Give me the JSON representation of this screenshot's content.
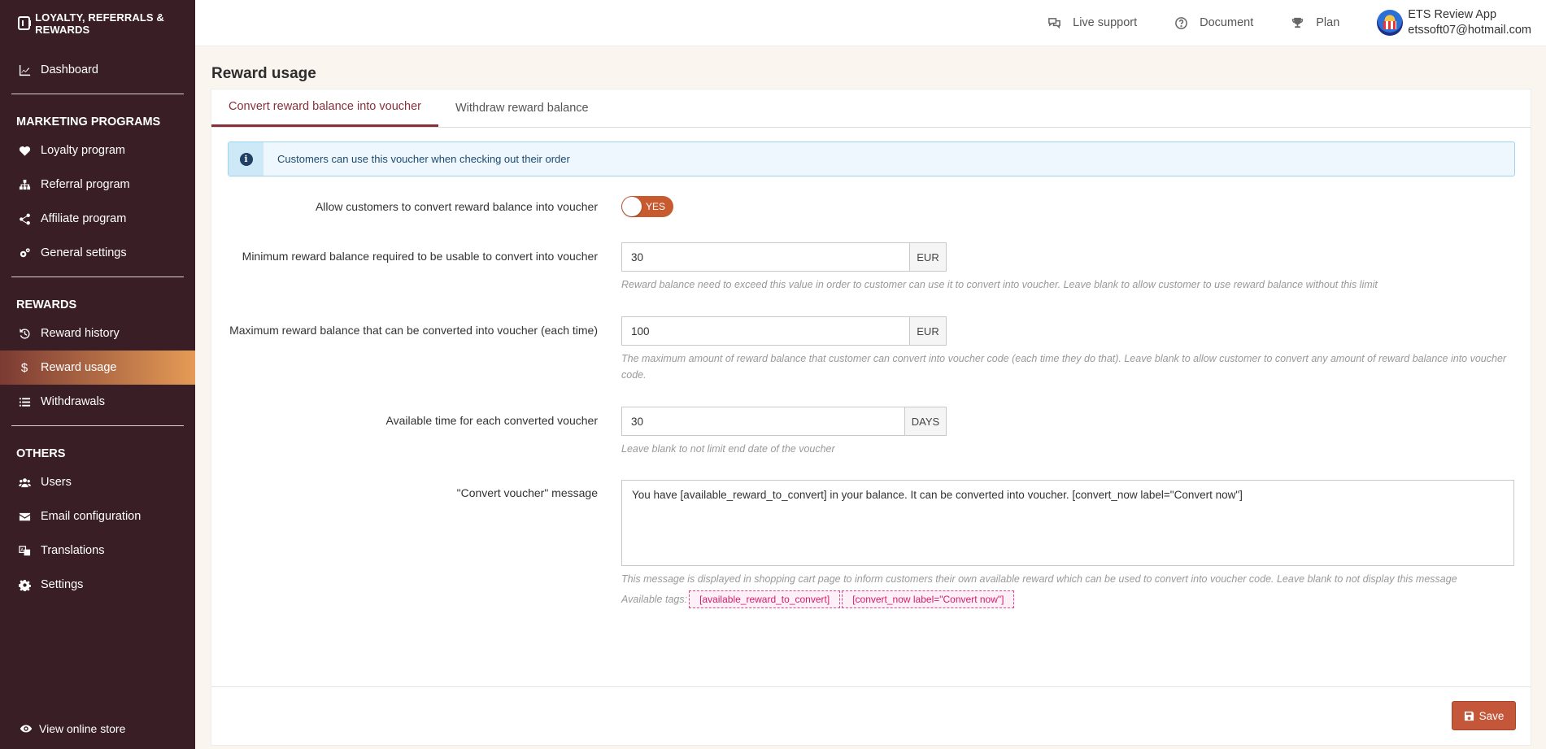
{
  "brand": "LOYALTY, REFERRALS & REWARDS",
  "sidebar": {
    "dashboard": "Dashboard",
    "marketing_title": "MARKETING PROGRAMS",
    "marketing": [
      "Loyalty program",
      "Referral program",
      "Affiliate program",
      "General settings"
    ],
    "rewards_title": "REWARDS",
    "rewards": [
      "Reward history",
      "Reward usage",
      "Withdrawals"
    ],
    "others_title": "OTHERS",
    "others": [
      "Users",
      "Email configuration",
      "Translations",
      "Settings"
    ],
    "view_store": "View online store"
  },
  "header": {
    "live_support": "Live support",
    "document": "Document",
    "plan": "Plan",
    "user_name": "ETS Review App",
    "user_email": "etssoft07@hotmail.com"
  },
  "page": {
    "title": "Reward usage",
    "tabs": [
      "Convert reward balance into voucher",
      "Withdraw reward balance"
    ],
    "alert": "Customers can use this voucher when checking out their order"
  },
  "form": {
    "allow_label": "Allow customers to convert reward balance into voucher",
    "allow_value": "YES",
    "min_label": "Minimum reward balance required to be usable to convert into voucher",
    "min_value": "30",
    "min_unit": "EUR",
    "min_help": "Reward balance need to exceed this value in order to customer can use it to convert into voucher. Leave blank to allow customer to use reward balance without this limit",
    "max_label": "Maximum reward balance that can be converted into voucher (each time)",
    "max_value": "100",
    "max_unit": "EUR",
    "max_help": "The maximum amount of reward balance that customer can convert into voucher code (each time they do that). Leave blank to allow customer to convert any amount of reward balance into voucher code.",
    "time_label": "Available time for each converted voucher",
    "time_value": "30",
    "time_unit": "DAYS",
    "time_help": "Leave blank to not limit end date of the voucher",
    "msg_label": "\"Convert voucher\" message",
    "msg_value": "You have [available_reward_to_convert] in your balance. It can be converted into voucher. [convert_now label=\"Convert now\"]",
    "msg_help": "This message is displayed in shopping cart page to inform customers their own available reward which can be used to convert into voucher code. Leave blank to not display this message",
    "tags_label": "Available tags:",
    "tags": [
      "[available_reward_to_convert]",
      "[convert_now label=\"Convert now\"]"
    ]
  },
  "save_label": "Save",
  "colors": {
    "sidebar_bg": "#3a1e26",
    "accent": "#8a2f3a",
    "toggle": "#c85a2f",
    "save": "#c4573a"
  }
}
